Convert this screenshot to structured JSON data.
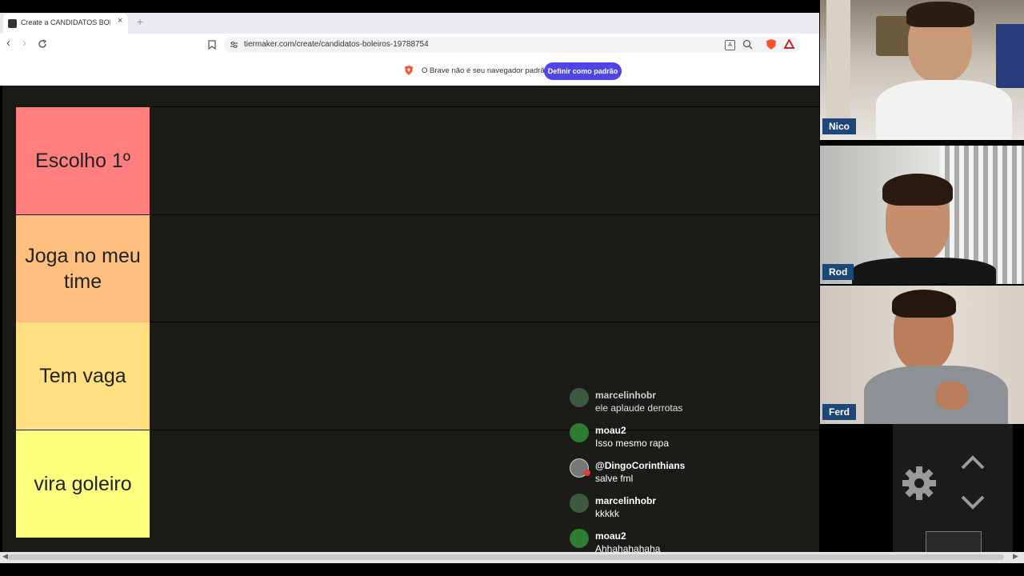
{
  "browser": {
    "tab_title": "Create a CANDIDATOS BOLEIRO",
    "tab_close": "×",
    "new_tab": "+",
    "url": "tiermaker.com/create/candidatos-boleiros-19788754",
    "infobar_text": "O Brave não é seu navegador padrão",
    "default_button": "Definir como padrão"
  },
  "tiers": [
    {
      "label": "Escolho 1º",
      "color": "#ff7f7f"
    },
    {
      "label": "Joga no meu time",
      "color": "#ffbf7f"
    },
    {
      "label": "Tem vaga",
      "color": "#ffdf7f"
    },
    {
      "label": "vira goleiro",
      "color": "#ffff7f"
    }
  ],
  "participants": [
    {
      "name": "Nico"
    },
    {
      "name": "Rod"
    },
    {
      "name": "Ferd"
    }
  ],
  "chat": [
    {
      "user": "marcelinhobr",
      "message": "ele aplaude derrotas",
      "avatar_color": "#3d5a40"
    },
    {
      "user": "moau2",
      "message": "Isso mesmo rapa",
      "avatar_color": "#2e7d32"
    },
    {
      "user": "@DingoCorinthians",
      "message": "salve fml",
      "avatar_color": "#777"
    },
    {
      "user": "marcelinhobr",
      "message": "kkkkk",
      "avatar_color": "#3d5a40"
    },
    {
      "user": "moau2",
      "message": "Ahhahahahaha",
      "avatar_color": "#2e7d32"
    }
  ],
  "icons": {
    "gear": "settings-gear-icon",
    "up": "chevron-up-icon",
    "down": "chevron-down-icon"
  }
}
